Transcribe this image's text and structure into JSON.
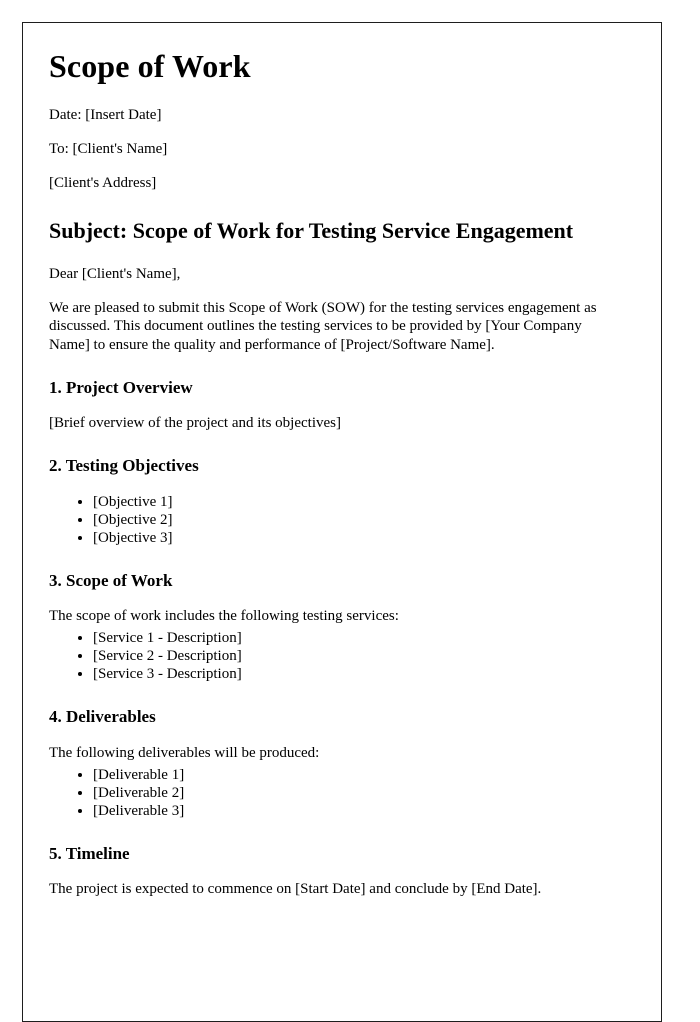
{
  "document": {
    "title": "Scope of Work",
    "meta": {
      "date_line": "Date: [Insert Date]",
      "to_line": "To: [Client's Name]",
      "address_line": "[Client's Address]"
    },
    "subject_heading": "Subject: Scope of Work for Testing Service Engagement",
    "salutation": "Dear [Client's Name],",
    "intro_paragraph": "We are pleased to submit this Scope of Work (SOW) for the testing services engagement as discussed. This document outlines the testing services to be provided by [Your Company Name] to ensure the quality and performance of [Project/Software Name].",
    "sections": [
      {
        "heading": "1. Project Overview",
        "body": "[Brief overview of the project and its objectives]"
      },
      {
        "heading": "2. Testing Objectives",
        "items": [
          "[Objective 1]",
          "[Objective 2]",
          "[Objective 3]"
        ]
      },
      {
        "heading": "3. Scope of Work",
        "body": "The scope of work includes the following testing services:",
        "items": [
          "[Service 1 - Description]",
          "[Service 2 - Description]",
          "[Service 3 - Description]"
        ]
      },
      {
        "heading": "4. Deliverables",
        "body": "The following deliverables will be produced:",
        "items": [
          "[Deliverable 1]",
          "[Deliverable 2]",
          "[Deliverable 3]"
        ]
      },
      {
        "heading": "5. Timeline",
        "body": "The project is expected to commence on [Start Date] and conclude by [End Date]."
      }
    ]
  }
}
